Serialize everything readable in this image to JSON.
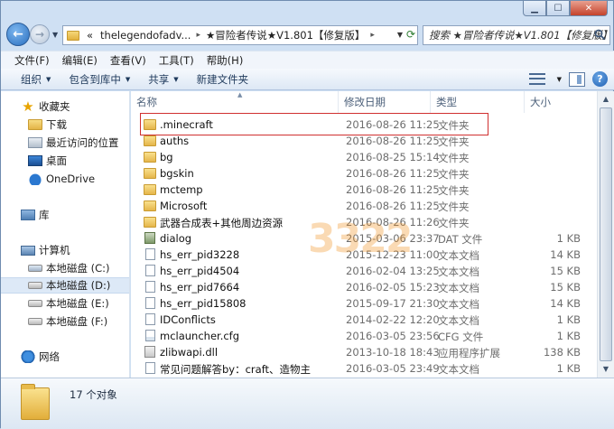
{
  "window": {
    "caption_buttons": [
      "minimize",
      "maximize",
      "close"
    ]
  },
  "address": {
    "history_marker": "«",
    "segments": [
      "thelegendofadv...",
      "★冒险者传说★V1.801【修复版】"
    ],
    "search_placeholder": "搜索 ★冒险者传说★V1.801【修复版】"
  },
  "menu": [
    "文件(F)",
    "编辑(E)",
    "查看(V)",
    "工具(T)",
    "帮助(H)"
  ],
  "toolbar": {
    "items": [
      "组织",
      "包含到库中",
      "共享",
      "新建文件夹"
    ]
  },
  "nav": {
    "favorites": "收藏夹",
    "downloads": "下载",
    "recent": "最近访问的位置",
    "desktop": "桌面",
    "onedrive": "OneDrive",
    "libraries": "库",
    "computer": "计算机",
    "drives": [
      "本地磁盘 (C:)",
      "本地磁盘 (D:)",
      "本地磁盘 (E:)",
      "本地磁盘 (F:)"
    ],
    "network": "网络"
  },
  "columns": {
    "name": "名称",
    "date": "修改日期",
    "type": "类型",
    "size": "大小"
  },
  "files": [
    {
      "name": ".minecraft",
      "date": "2016-08-26 11:25",
      "type": "文件夹",
      "size": "",
      "icon": "folder"
    },
    {
      "name": "auths",
      "date": "2016-08-26 11:25",
      "type": "文件夹",
      "size": "",
      "icon": "folder"
    },
    {
      "name": "bg",
      "date": "2016-08-25 15:14",
      "type": "文件夹",
      "size": "",
      "icon": "folder"
    },
    {
      "name": "bgskin",
      "date": "2016-08-26 11:25",
      "type": "文件夹",
      "size": "",
      "icon": "folder"
    },
    {
      "name": "mctemp",
      "date": "2016-08-26 11:25",
      "type": "文件夹",
      "size": "",
      "icon": "folder"
    },
    {
      "name": "Microsoft",
      "date": "2016-08-26 11:25",
      "type": "文件夹",
      "size": "",
      "icon": "folder"
    },
    {
      "name": "武器合成表+其他周边资源",
      "date": "2016-08-26 11:26",
      "type": "文件夹",
      "size": "",
      "icon": "folder"
    },
    {
      "name": "dialog",
      "date": "2015-03-06 23:37",
      "type": "DAT 文件",
      "size": "1 KB",
      "icon": "dat"
    },
    {
      "name": "hs_err_pid3228",
      "date": "2015-12-23 11:00",
      "type": "文本文档",
      "size": "14 KB",
      "icon": "doc"
    },
    {
      "name": "hs_err_pid4504",
      "date": "2016-02-04 13:25",
      "type": "文本文档",
      "size": "15 KB",
      "icon": "doc"
    },
    {
      "name": "hs_err_pid7664",
      "date": "2016-02-05 15:23",
      "type": "文本文档",
      "size": "15 KB",
      "icon": "doc"
    },
    {
      "name": "hs_err_pid15808",
      "date": "2015-09-17 21:30",
      "type": "文本文档",
      "size": "14 KB",
      "icon": "doc"
    },
    {
      "name": "IDConflicts",
      "date": "2014-02-22 12:20",
      "type": "文本文档",
      "size": "1 KB",
      "icon": "doc"
    },
    {
      "name": "mclauncher.cfg",
      "date": "2016-03-05 23:56",
      "type": "CFG 文件",
      "size": "1 KB",
      "icon": "cfg"
    },
    {
      "name": "zlibwapi.dll",
      "date": "2013-10-18 18:43",
      "type": "应用程序扩展",
      "size": "138 KB",
      "icon": "dll"
    },
    {
      "name": "常见问题解答by：craft、造物主",
      "date": "2016-03-05 23:49",
      "type": "文本文档",
      "size": "1 KB",
      "icon": "doc"
    }
  ],
  "watermark": "3322",
  "status": {
    "count": "17 个对象"
  },
  "colors": {
    "highlight": "#d03030",
    "folder": "#e5b64a",
    "selection": "#dde9f7"
  }
}
